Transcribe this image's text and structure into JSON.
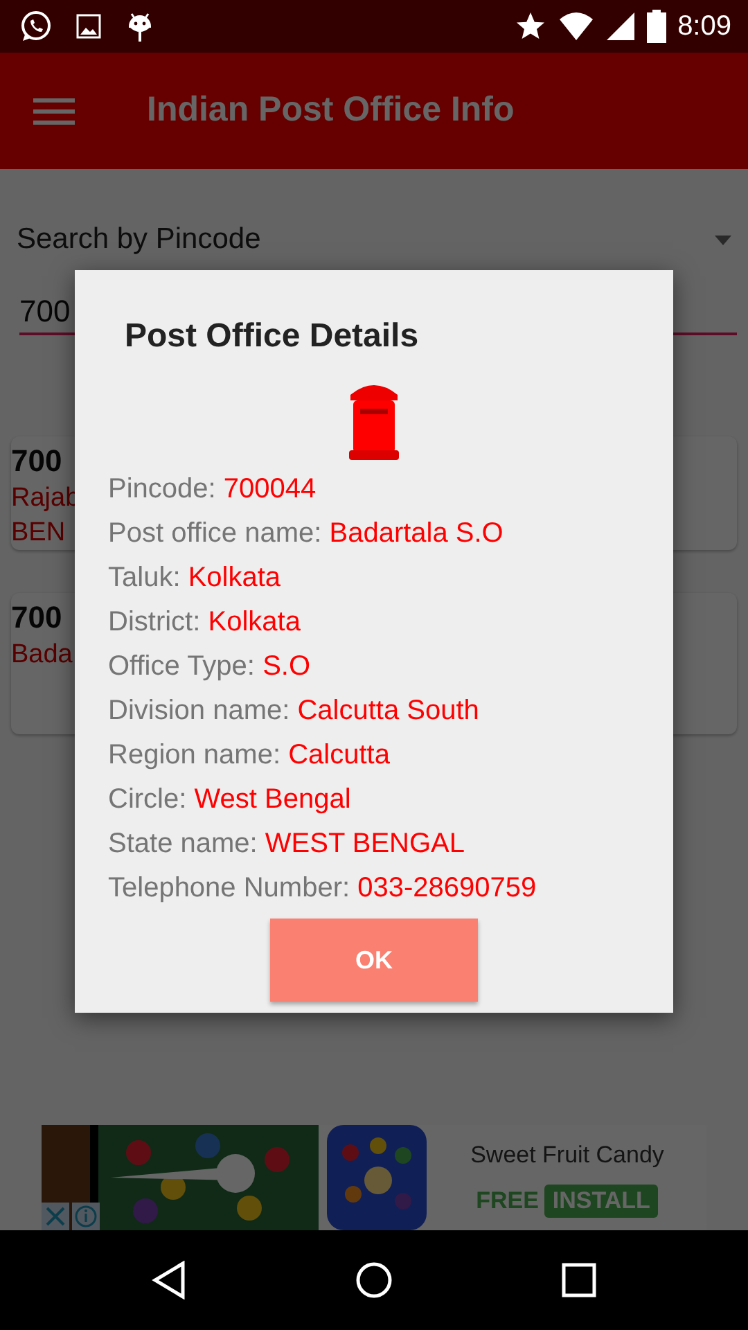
{
  "status_bar": {
    "time": "8:09"
  },
  "app_bar": {
    "title": "Indian Post Office Info"
  },
  "search": {
    "mode_label": "Search by Pincode",
    "pincode_value": "700"
  },
  "results": [
    {
      "pincode": "700",
      "lines": [
        "Rajab",
        "BEN"
      ]
    },
    {
      "pincode": "700",
      "lines": [
        "Bada"
      ]
    }
  ],
  "dialog": {
    "title": "Post Office Details",
    "fields": [
      {
        "label": "Pincode:",
        "value": "700044"
      },
      {
        "label": "Post office name:",
        "value": "Badartala S.O"
      },
      {
        "label": "Taluk:",
        "value": "Kolkata"
      },
      {
        "label": "District:",
        "value": "Kolkata"
      },
      {
        "label": "Office Type:",
        "value": "S.O"
      },
      {
        "label": "Division name:",
        "value": "Calcutta South"
      },
      {
        "label": "Region name:",
        "value": "Calcutta"
      },
      {
        "label": "Circle:",
        "value": "West Bengal"
      },
      {
        "label": "State name:",
        "value": "WEST BENGAL"
      },
      {
        "label": "Telephone Number:",
        "value": "033-28690759"
      }
    ],
    "ok_button": "OK"
  },
  "ad": {
    "title": "Sweet Fruit Candy",
    "price": "FREE",
    "install_button": "INSTALL"
  }
}
